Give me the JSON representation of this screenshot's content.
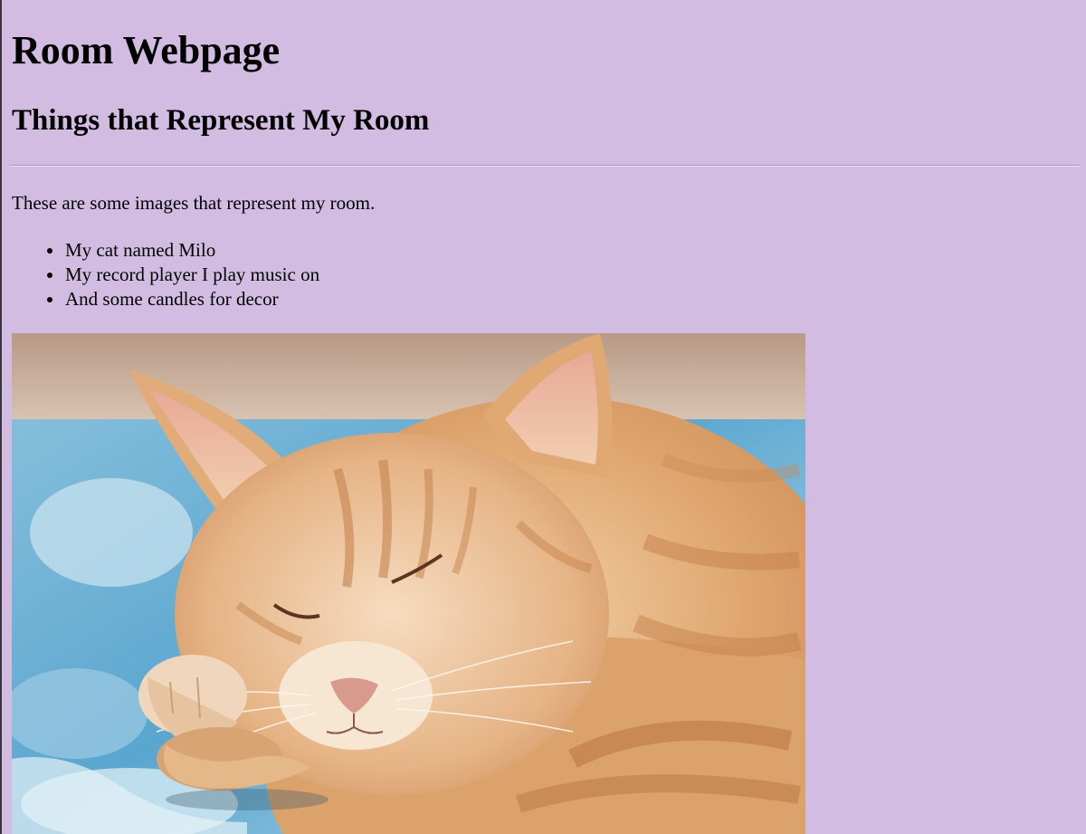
{
  "page": {
    "title": "Room Webpage",
    "subtitle": "Things that Represent My Room",
    "intro": "These are some images that represent my room.",
    "items": [
      "My cat named Milo",
      "My record player I play music on",
      "And some candles for decor"
    ]
  },
  "colors": {
    "background": "#d2bce2"
  },
  "image": {
    "subject": "sleeping orange tabby cat on a blue rug"
  }
}
